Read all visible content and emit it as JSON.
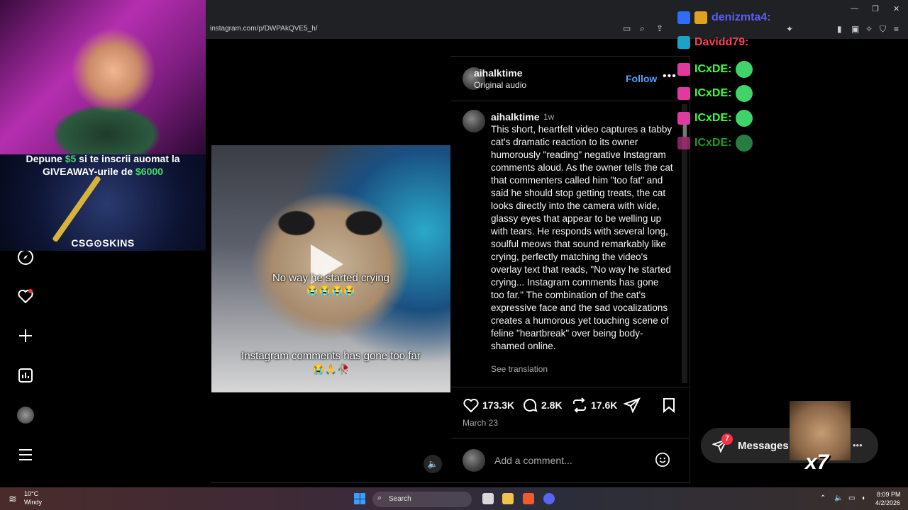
{
  "browser": {
    "url": "instagram.com/p/DWPAkQVE5_h/",
    "window_controls": [
      "—",
      "❐",
      "✕"
    ]
  },
  "stream_overlay": {
    "promo_line1_a": "Depune ",
    "promo_amount": "$5",
    "promo_line1_b": " si te inscrii auomat la",
    "promo_line2_a": "GIVEAWAY-urile de ",
    "promo_prize": "$6000",
    "promo_brand": "CSG⊙SKINS",
    "chat": [
      {
        "user": "denizmta4:",
        "color": "#5b5bff"
      },
      {
        "user": "Davidd79:",
        "color": "#ff3c5a"
      },
      {
        "user": "ICxDE:",
        "color": "#39ff39"
      },
      {
        "user": "ICxDE:",
        "color": "#39ff39"
      },
      {
        "user": "ICxDE:",
        "color": "#39ff39"
      },
      {
        "user": "ICxDE:",
        "color": "#39ff39"
      }
    ],
    "face_emote_count": "x7"
  },
  "sidebar": {
    "items": [
      "explore-icon",
      "notifications-icon",
      "create-icon",
      "dashboard-icon",
      "profile-avatar",
      "menu-icon"
    ]
  },
  "post": {
    "video": {
      "caption_top": "No way he started crying",
      "caption_top_emoji": "😭😭😭😭",
      "caption_bottom": "Instagram comments has gone too far",
      "caption_bottom_emoji": "😭🙏🥀",
      "volume_icon": "🔈"
    },
    "header": {
      "username": "aihalktime",
      "audio": "Original audio",
      "follow": "Follow",
      "more": "•••"
    },
    "caption": {
      "username": "aihalktime",
      "time": "1w",
      "text": "This short, heartfelt video captures a tabby cat's dramatic reaction to its owner humorously \"reading\" negative Instagram comments aloud. As the owner tells the cat that commenters called him \"too fat\" and said he should stop getting treats, the cat looks directly into the camera with wide, glassy eyes that appear to be welling up with tears. He responds with several long, soulful meows that sound remarkably like crying, perfectly matching the video's overlay text that reads, \"No way he started crying... Instagram comments has gone too far.\" The combination of the cat's expressive face and the sad vocalizations creates a humorous yet touching scene of feline \"heartbreak\" over being body-shamed online.",
      "see_translation": "See translation"
    },
    "actions": {
      "likes": "173.3K",
      "comments": "2.8K",
      "reposts": "17.6K"
    },
    "date": "March 23",
    "comment_placeholder": "Add a comment..."
  },
  "messages": {
    "label": "Messages",
    "badge": "7",
    "more": "•••"
  },
  "taskbar": {
    "weather_temp": "10°C",
    "weather_desc": "Windy",
    "search": "Search",
    "time": "8:09 PM",
    "date": "4/2/2026"
  }
}
